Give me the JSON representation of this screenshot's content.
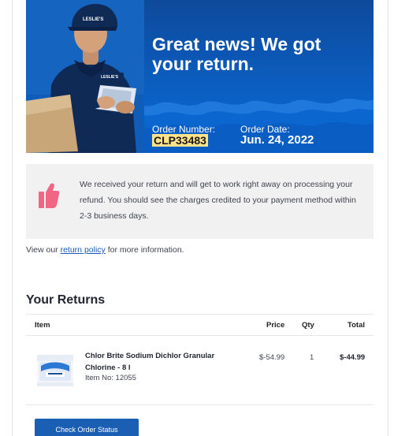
{
  "hero": {
    "title": "Great news! We got your return.",
    "order_number_label": "Order Number:",
    "order_number": "CLP33483",
    "order_date_label": "Order Date:",
    "order_date": "Jun. 24, 2022",
    "brand_cap": "LESLIE'S",
    "brand_shirt": "LESLIE'S"
  },
  "notice": {
    "text": "We received your return and will get to work right away on processing your refund. You should see the charges credited to your payment method within 2-3 business days.",
    "icon": "thumbs-up-icon"
  },
  "policy": {
    "prefix": "View our ",
    "link_text": "return policy",
    "suffix": " for more information."
  },
  "returns": {
    "title": "Your Returns",
    "headers": {
      "item": "Item",
      "price": "Price",
      "qty": "Qty",
      "total": "Total"
    },
    "items": [
      {
        "name": "Chlor Brite Sodium Dichlor Granular Chlorine - 8 l",
        "item_no": "Item No: 12055",
        "price": "$-54.99",
        "qty": "1",
        "total": "$-44.99"
      }
    ]
  },
  "cta": {
    "label": "Check Order Status"
  },
  "colors": {
    "hero_blue": "#0b5dbf",
    "button_blue": "#1b5fb5",
    "highlight": "#ffe38a",
    "thumb": "#f16683",
    "notice_bg": "#f1f1f2"
  }
}
